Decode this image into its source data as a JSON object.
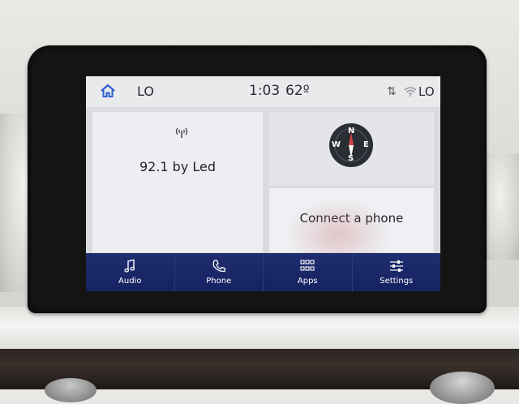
{
  "status_bar": {
    "left_text": "LO",
    "time": "1:03",
    "temperature": "62º",
    "right_text": "LO"
  },
  "radio_tile": {
    "station": "92.1 by Led"
  },
  "compass": {
    "n": "N",
    "e": "E",
    "s": "S",
    "w": "W"
  },
  "phone_tile": {
    "message": "Connect a phone"
  },
  "nav": {
    "audio": "Audio",
    "phone": "Phone",
    "apps": "Apps",
    "settings": "Settings"
  },
  "colors": {
    "nav_bg": "#1a2766",
    "home_icon": "#2f5fd0"
  }
}
